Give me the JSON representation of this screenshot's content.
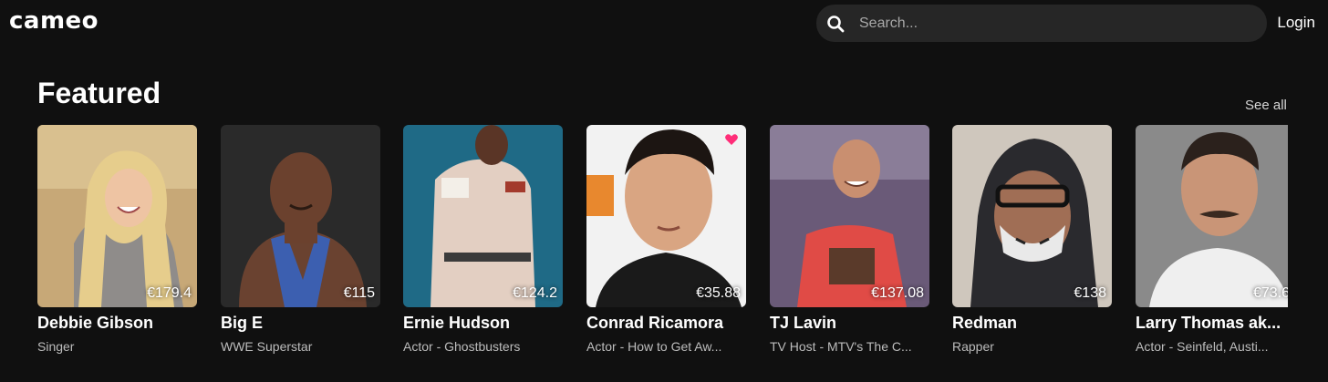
{
  "brand": {
    "logo_text": "cameo"
  },
  "search": {
    "placeholder": "Search..."
  },
  "header": {
    "login_label": "Login"
  },
  "featured": {
    "title": "Featured",
    "see_all_label": "See all",
    "cards": [
      {
        "name": "Debbie Gibson",
        "subtitle": "Singer",
        "price": "€179.4",
        "favorited": false
      },
      {
        "name": "Big E",
        "subtitle": "WWE Superstar",
        "price": "€115",
        "favorited": false
      },
      {
        "name": "Ernie Hudson",
        "subtitle": "Actor - Ghostbusters",
        "price": "€124.2",
        "favorited": false
      },
      {
        "name": "Conrad Ricamora",
        "subtitle": "Actor - How to Get Aw...",
        "price": "€35.88",
        "favorited": true
      },
      {
        "name": "TJ Lavin",
        "subtitle": "TV Host - MTV's The C...",
        "price": "€137.08",
        "favorited": false
      },
      {
        "name": "Redman",
        "subtitle": "Rapper",
        "price": "€138",
        "favorited": false
      },
      {
        "name": "Larry Thomas ak...",
        "subtitle": "Actor - Seinfeld, Austi...",
        "price": "€73.6",
        "favorited": false
      }
    ]
  },
  "colors": {
    "background": "#101010",
    "search_bg": "#262626",
    "heart": "#ff2d78",
    "subtitle": "#bdbdbd"
  }
}
